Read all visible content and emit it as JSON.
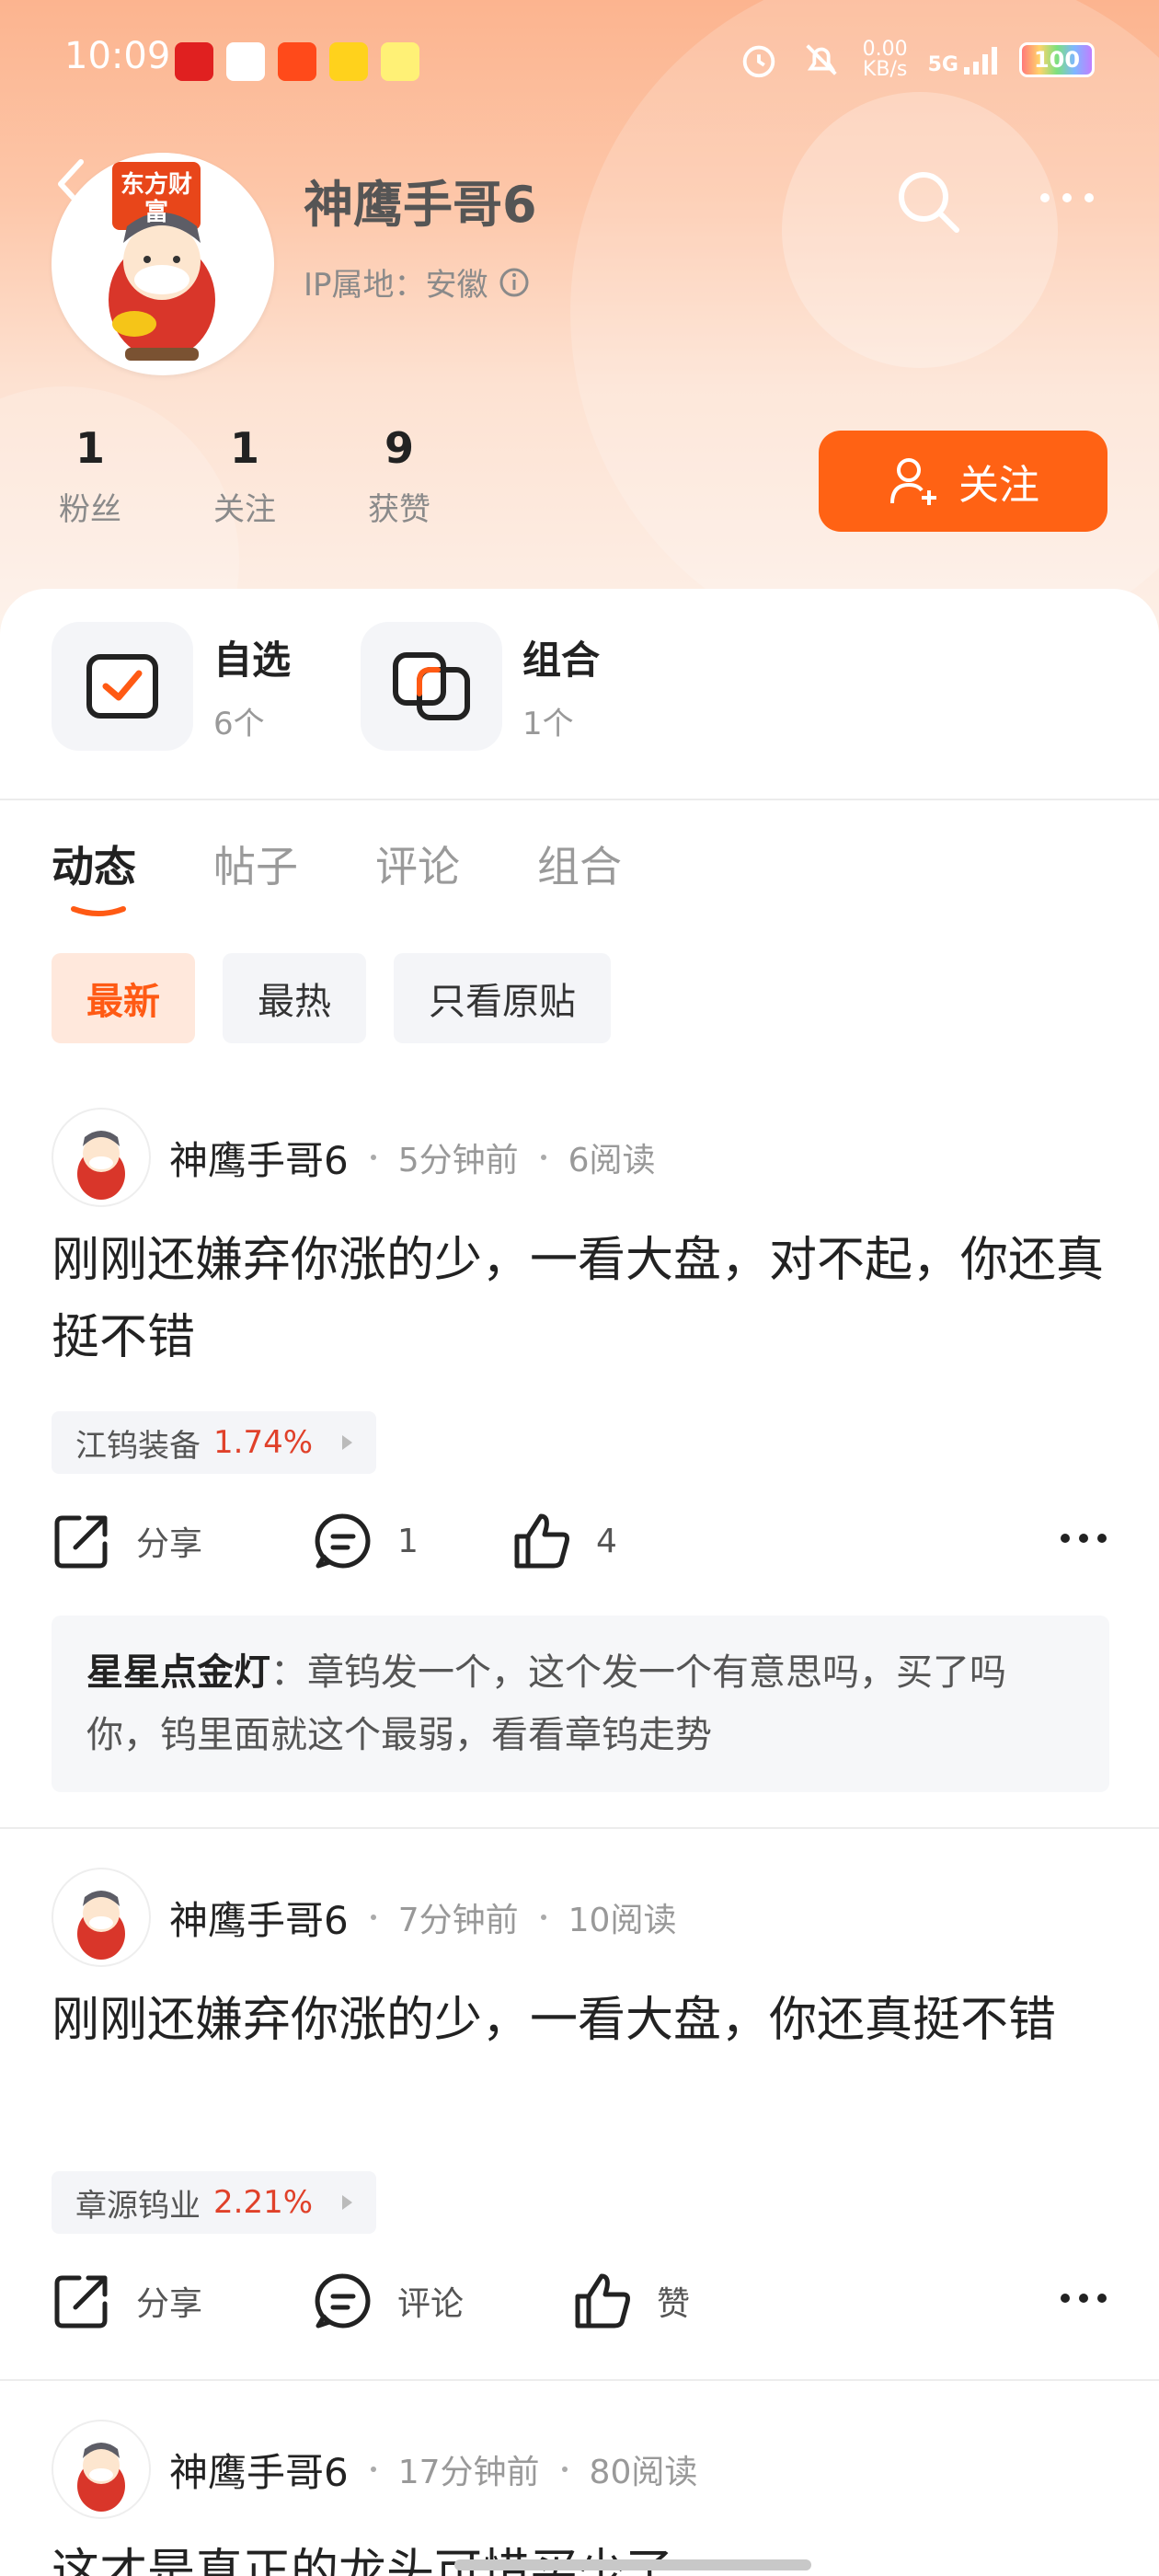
{
  "status_bar": {
    "time": "10:09",
    "net_speed_value": "0.00",
    "net_speed_unit": "KB/s",
    "network": "5G",
    "battery": "100"
  },
  "profile": {
    "name": "神鹰手哥6",
    "ip_location": "IP属地：安徽",
    "stats": [
      {
        "value": "1",
        "label": "粉丝"
      },
      {
        "value": "1",
        "label": "关注"
      },
      {
        "value": "9",
        "label": "获赞"
      }
    ],
    "follow_label": "关注",
    "avatar_badge": "东方财富"
  },
  "quick": [
    {
      "title": "自选",
      "sub": "6个"
    },
    {
      "title": "组合",
      "sub": "1个"
    }
  ],
  "tabs": [
    "动态",
    "帖子",
    "评论",
    "组合"
  ],
  "filters": [
    "最新",
    "最热",
    "只看原贴"
  ],
  "posts": [
    {
      "author": "神鹰手哥6",
      "time": "5分钟前",
      "reads": "6阅读",
      "body": "刚刚还嫌弃你涨的少，一看大盘，对不起，你还真挺不错",
      "stock_name": "江钨装备",
      "stock_change": "1.74%",
      "share": "分享",
      "comments": "1",
      "likes": "4",
      "comment_author": "星星点金灯",
      "comment_text": "：章钨发一个，这个发一个有意思吗，买了吗你，钨里面就这个最弱，看看章钨走势"
    },
    {
      "author": "神鹰手哥6",
      "time": "7分钟前",
      "reads": "10阅读",
      "body": "刚刚还嫌弃你涨的少，一看大盘，你还真挺不错",
      "stock_name": "章源钨业",
      "stock_change": "2.21%",
      "share": "分享",
      "comments": "评论",
      "likes": "赞"
    },
    {
      "author": "神鹰手哥6",
      "time": "17分钟前",
      "reads": "80阅读",
      "body": "这才是真正的龙头可惜买少了"
    }
  ],
  "colors": {
    "accent": "#ff6214",
    "stock_up": "#e0412a"
  }
}
